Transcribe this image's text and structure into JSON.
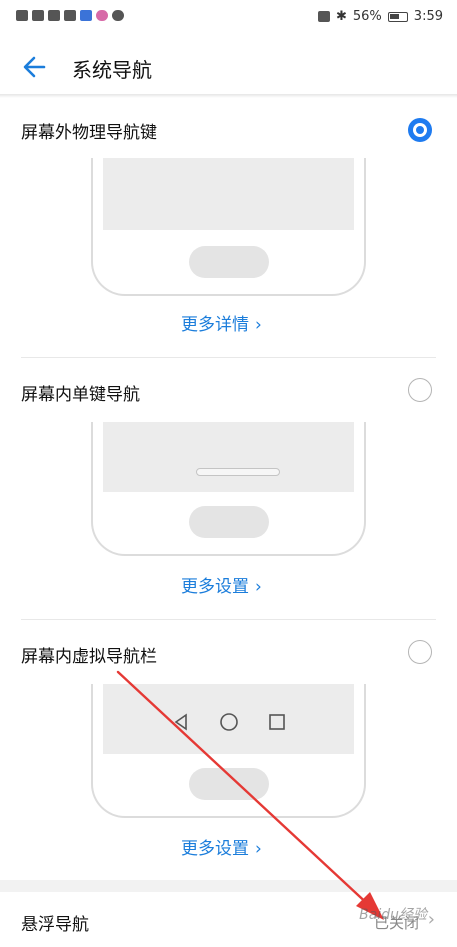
{
  "statusbar": {
    "battery": "56%",
    "time": "3:59"
  },
  "header": {
    "title": "系统导航"
  },
  "options": [
    {
      "label": "屏幕外物理导航键",
      "selected": true,
      "link": "更多详情"
    },
    {
      "label": "屏幕内单键导航",
      "selected": false,
      "link": "更多设置"
    },
    {
      "label": "屏幕内虚拟导航栏",
      "selected": false,
      "link": "更多设置"
    }
  ],
  "float_nav": {
    "label": "悬浮导航",
    "value": "已关闭"
  },
  "watermark": "Baidu经验",
  "colors": {
    "accent": "#1e7bf0",
    "link": "#1b7ddb",
    "annotation": "#e53935"
  },
  "icons": [
    "hd-icon",
    "signal-icon",
    "download-icon",
    "vpn-icon",
    "browser-icon",
    "message-icon",
    "nfc-icon",
    "bluetooth-icon",
    "battery-icon",
    "back-arrow-icon",
    "back-nav-icon",
    "home-nav-icon",
    "recents-nav-icon",
    "chevron-right-icon"
  ]
}
